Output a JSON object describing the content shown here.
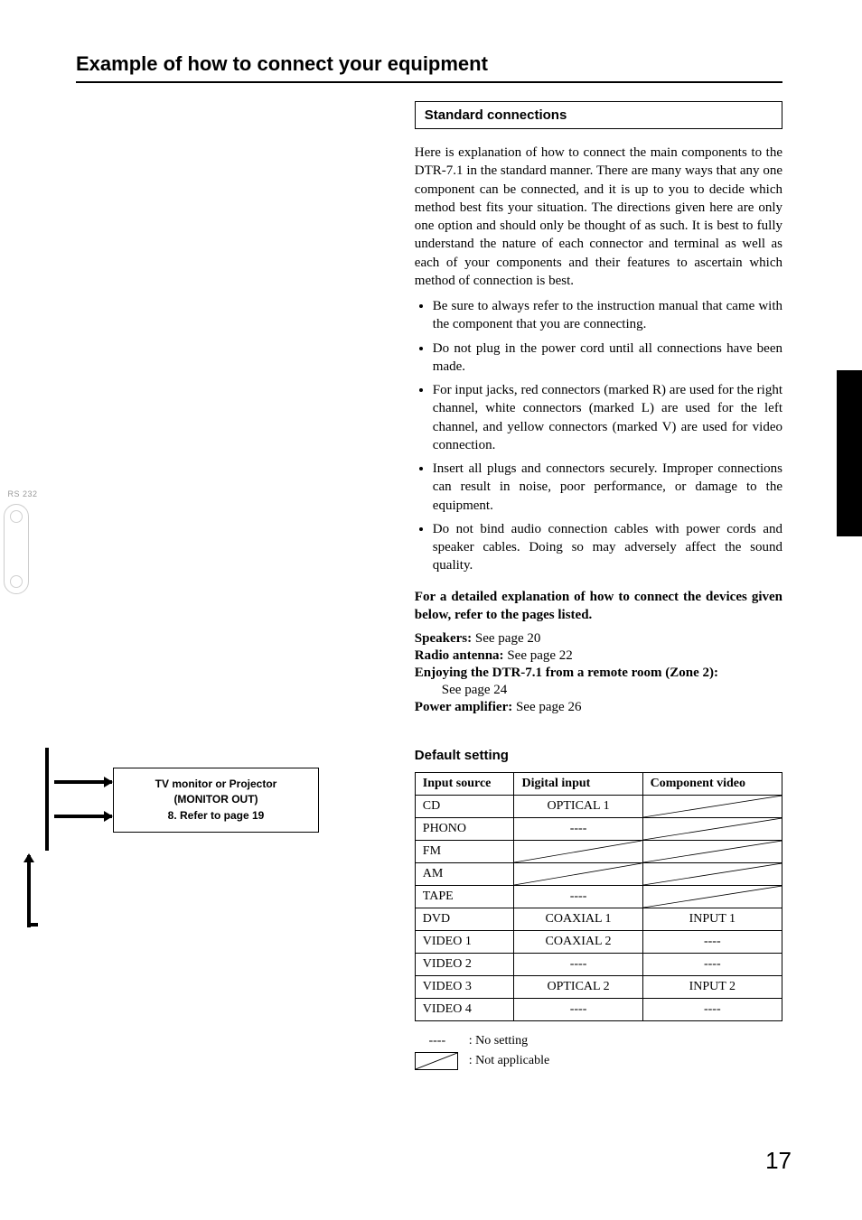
{
  "page_number": "17",
  "title": "Example of how to connect your equipment",
  "left": {
    "rs232_label": "RS 232",
    "tv_box_l1": "TV monitor or Projector",
    "tv_box_l2": "(MONITOR OUT)",
    "tv_box_l3": "8. Refer to page 19"
  },
  "right": {
    "standard_heading": "Standard connections",
    "intro": "Here is explanation of how to connect the main components to the DTR-7.1 in the standard manner. There are many ways that any one component can be connected, and it is up to you to decide which method best fits your situation. The directions given here are only one option and should only be thought of as such. It is best to fully understand the nature of each connector and terminal as well as each of your components and their features to ascertain which method of connection is best.",
    "bullets": [
      "Be sure to always refer to the instruction manual that came with the component that you are connecting.",
      "Do not plug in the power cord until all connections have been made.",
      "For input jacks, red connectors (marked R) are used for the right channel, white connectors (marked L) are used for the left channel, and yellow connectors (marked V) are used for video connection.",
      "Insert all plugs and connectors securely. Improper connections can result in noise, poor performance, or damage to the equipment.",
      "Do not bind audio connection cables with power cords and speaker cables. Doing so may adversely affect the sound quality."
    ],
    "detailed_note": "For a detailed explanation of how to connect the devices given below, refer to the pages listed.",
    "refs": {
      "speakers_label": "Speakers:",
      "speakers_val": " See page 20",
      "radio_label": "Radio antenna:",
      "radio_val": " See page 22",
      "zone2_label": "Enjoying the DTR-7.1 from a remote room (Zone 2):",
      "zone2_val": "See page 24",
      "power_label": "Power amplifier:",
      "power_val": " See page 26"
    },
    "default_heading": "Default setting",
    "legend": {
      "dashes_sym": "----",
      "dashes_txt": ": No setting",
      "na_txt": ": Not applicable"
    }
  },
  "chart_data": {
    "type": "table",
    "columns": [
      "Input source",
      "Digital input",
      "Component video"
    ],
    "rows": [
      {
        "src": "CD",
        "digital": "OPTICAL 1",
        "component": "NA"
      },
      {
        "src": "PHONO",
        "digital": "----",
        "component": "NA"
      },
      {
        "src": "FM",
        "digital": "NA",
        "component": "NA"
      },
      {
        "src": "AM",
        "digital": "NA",
        "component": "NA"
      },
      {
        "src": "TAPE",
        "digital": "----",
        "component": "NA"
      },
      {
        "src": "DVD",
        "digital": "COAXIAL 1",
        "component": "INPUT 1"
      },
      {
        "src": "VIDEO 1",
        "digital": "COAXIAL 2",
        "component": "----"
      },
      {
        "src": "VIDEO 2",
        "digital": "----",
        "component": "----"
      },
      {
        "src": "VIDEO 3",
        "digital": "OPTICAL 2",
        "component": "INPUT 2"
      },
      {
        "src": "VIDEO 4",
        "digital": "----",
        "component": "----"
      }
    ]
  }
}
